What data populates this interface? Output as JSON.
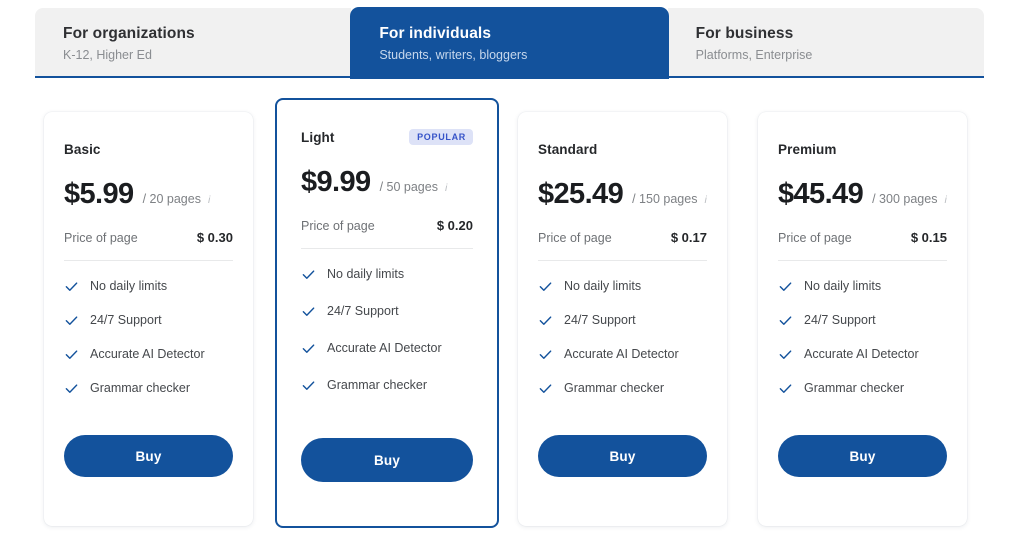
{
  "tabs": [
    {
      "title": "For organizations",
      "subtitle": "K-12, Higher Ed",
      "active": false
    },
    {
      "title": "For individuals",
      "subtitle": "Students, writers, bloggers",
      "active": true
    },
    {
      "title": "For business",
      "subtitle": "Platforms, Enterprise",
      "active": false
    }
  ],
  "colors": {
    "brand_blue": "#13529c",
    "badge_bg": "#dde2f7",
    "badge_text": "#3653c8",
    "tab_inactive_bg": "#f1f1f1"
  },
  "labels": {
    "price_of_page": "Price of page",
    "buy": "Buy",
    "info_icon": "i"
  },
  "plans": [
    {
      "name": "Basic",
      "badge": "",
      "price": "$5.99",
      "pages": "/ 20 pages",
      "price_of_page_label": "Price of page",
      "price_of_page_value": "$ 0.30",
      "features": [
        "No daily limits",
        "24/7 Support",
        "Accurate AI Detector",
        "Grammar checker"
      ],
      "buy_label": "Buy"
    },
    {
      "name": "Light",
      "badge": "POPULAR",
      "price": "$9.99",
      "pages": "/ 50 pages",
      "price_of_page_label": "Price of page",
      "price_of_page_value": "$ 0.20",
      "features": [
        "No daily limits",
        "24/7 Support",
        "Accurate AI Detector",
        "Grammar checker"
      ],
      "buy_label": "Buy"
    },
    {
      "name": "Standard",
      "badge": "",
      "price": "$25.49",
      "pages": "/ 150 pages",
      "price_of_page_label": "Price of page",
      "price_of_page_value": "$ 0.17",
      "features": [
        "No daily limits",
        "24/7 Support",
        "Accurate AI Detector",
        "Grammar checker"
      ],
      "buy_label": "Buy"
    },
    {
      "name": "Premium",
      "badge": "",
      "price": "$45.49",
      "pages": "/ 300 pages",
      "price_of_page_label": "Price of page",
      "price_of_page_value": "$ 0.15",
      "features": [
        "No daily limits",
        "24/7 Support",
        "Accurate AI Detector",
        "Grammar checker"
      ],
      "buy_label": "Buy"
    }
  ]
}
